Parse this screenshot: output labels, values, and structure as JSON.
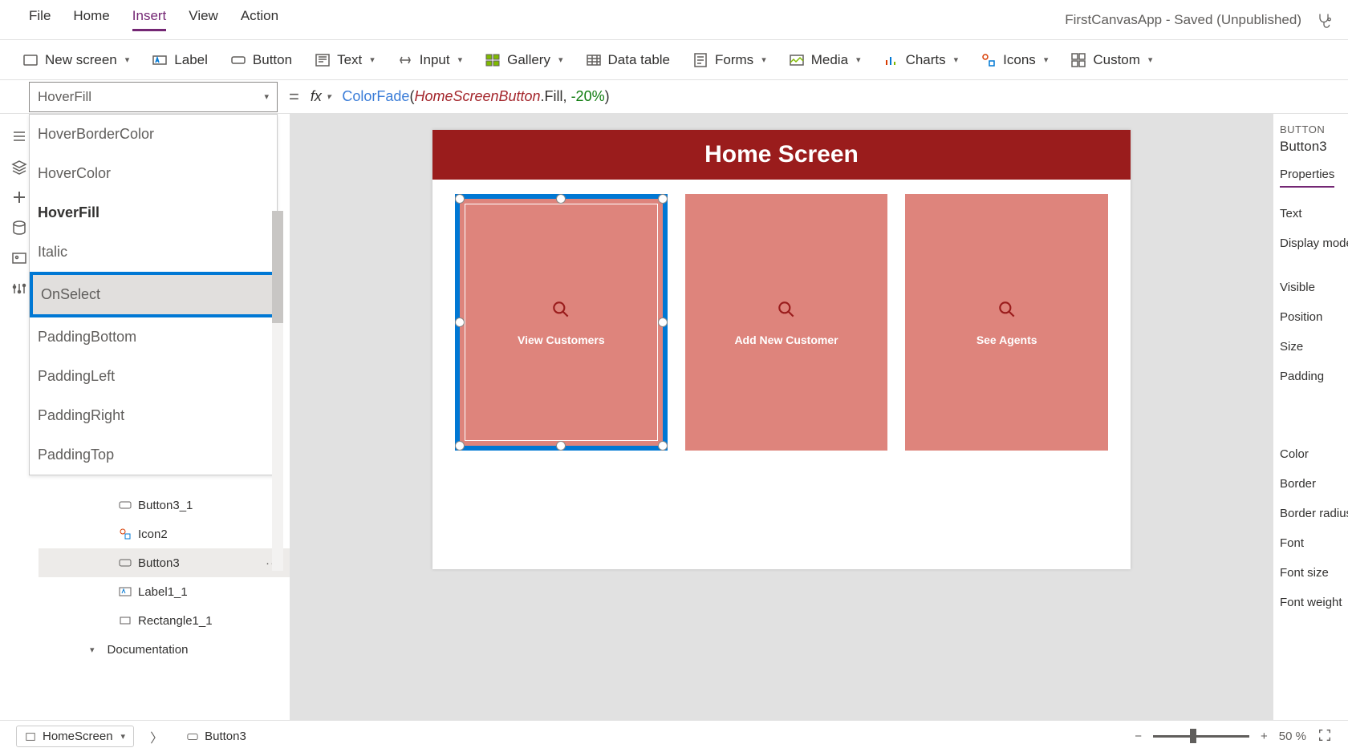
{
  "title": "FirstCanvasApp - Saved (Unpublished)",
  "menus": [
    "File",
    "Home",
    "Insert",
    "View",
    "Action"
  ],
  "active_menu": "Insert",
  "ribbon": {
    "new_screen": "New screen",
    "label": "Label",
    "button": "Button",
    "text": "Text",
    "input": "Input",
    "gallery": "Gallery",
    "data_table": "Data table",
    "forms": "Forms",
    "media": "Media",
    "charts": "Charts",
    "icons": "Icons",
    "custom": "Custom"
  },
  "property_selector": "HoverFill",
  "formula": {
    "fn": "ColorFade",
    "var": "HomeScreenButton",
    "prop": ".Fill",
    "sep": ", ",
    "num": "-20%"
  },
  "dropdown_items": [
    {
      "label": "HoverBorderColor",
      "bold": false
    },
    {
      "label": "HoverColor",
      "bold": false
    },
    {
      "label": "HoverFill",
      "bold": true
    },
    {
      "label": "Italic",
      "bold": false
    },
    {
      "label": "OnSelect",
      "bold": false,
      "highlight": true
    },
    {
      "label": "PaddingBottom",
      "bold": false
    },
    {
      "label": "PaddingLeft",
      "bold": false
    },
    {
      "label": "PaddingRight",
      "bold": false
    },
    {
      "label": "PaddingTop",
      "bold": false
    }
  ],
  "tree": {
    "items": [
      {
        "label": "Button3_1",
        "icon": "button"
      },
      {
        "label": "Icon2",
        "icon": "icon"
      },
      {
        "label": "Button3",
        "icon": "button",
        "selected": true
      },
      {
        "label": "Label1_1",
        "icon": "label"
      },
      {
        "label": "Rectangle1_1",
        "icon": "rect"
      }
    ],
    "group": "Documentation"
  },
  "canvas": {
    "header": "Home Screen",
    "cards": [
      "View Customers",
      "Add New Customer",
      "See Agents"
    ]
  },
  "properties": {
    "type_label": "BUTTON",
    "name": "Button3",
    "tab": "Properties",
    "rows": [
      "Text",
      "Display mode",
      "Visible",
      "Position",
      "Size",
      "Padding",
      "Color",
      "Border",
      "Border radius",
      "Font",
      "Font size",
      "Font weight"
    ]
  },
  "status": {
    "crumb1": "HomeScreen",
    "crumb2": "Button3",
    "zoom": "50",
    "zoom_unit": "%"
  }
}
